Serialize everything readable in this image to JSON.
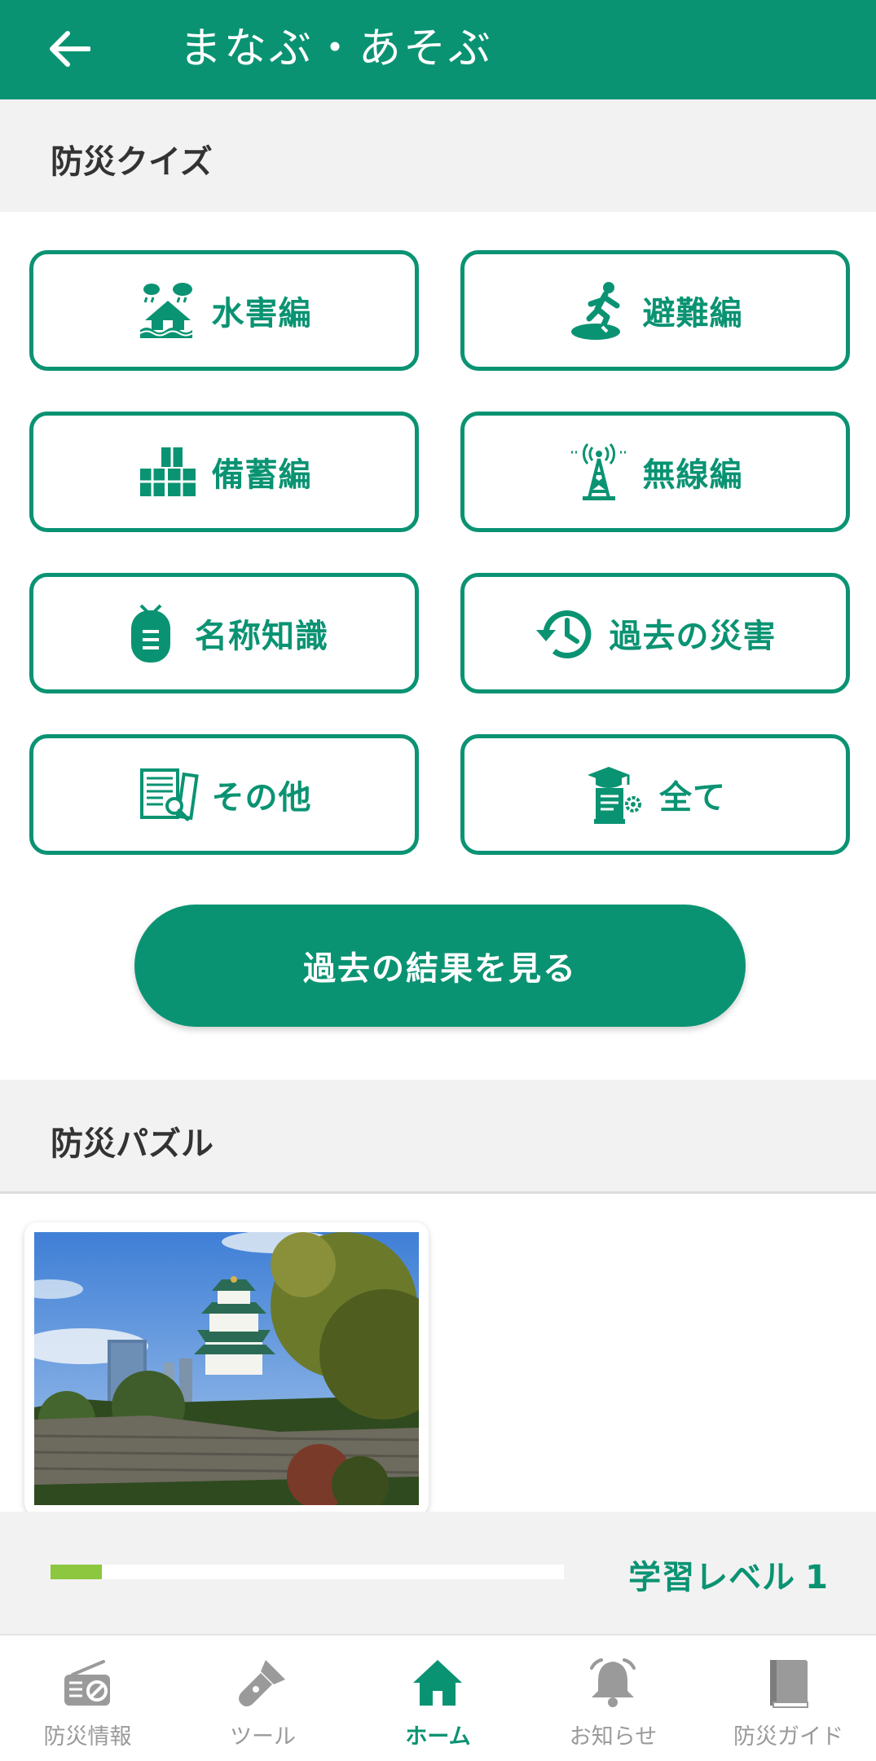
{
  "colors": {
    "primary": "#0a9372",
    "progress": "#8dc63f",
    "inactive": "#9a9a9a"
  },
  "appbar": {
    "title": "まなぶ・あそぶ",
    "back_icon": "arrow-left-icon"
  },
  "quiz_section": {
    "title": "防災クイズ",
    "buttons": [
      {
        "label": "水害編",
        "icon": "flooded-house-icon"
      },
      {
        "label": "避難編",
        "icon": "running-person-icon"
      },
      {
        "label": "備蓄編",
        "icon": "stockpile-boxes-icon"
      },
      {
        "label": "無線編",
        "icon": "radio-tower-icon"
      },
      {
        "label": "名称知識",
        "icon": "tag-icon"
      },
      {
        "label": "過去の災害",
        "icon": "history-clock-icon"
      },
      {
        "label": "その他",
        "icon": "documents-search-icon"
      },
      {
        "label": "全て",
        "icon": "graduation-scroll-icon"
      }
    ],
    "results_button": "過去の結果を見る"
  },
  "puzzle_section": {
    "title": "防災パズル",
    "items": [
      {
        "image": "castle-photo"
      }
    ]
  },
  "learning": {
    "label": "学習レベル",
    "level": "1",
    "progress": 0.1
  },
  "bottom_nav": {
    "items": [
      {
        "label": "防災情報",
        "icon": "radio-icon",
        "active": false
      },
      {
        "label": "ツール",
        "icon": "flashlight-icon",
        "active": false
      },
      {
        "label": "ホーム",
        "icon": "home-icon",
        "active": true
      },
      {
        "label": "お知らせ",
        "icon": "bell-icon",
        "active": false
      },
      {
        "label": "防災ガイド",
        "icon": "book-icon",
        "active": false
      }
    ]
  }
}
